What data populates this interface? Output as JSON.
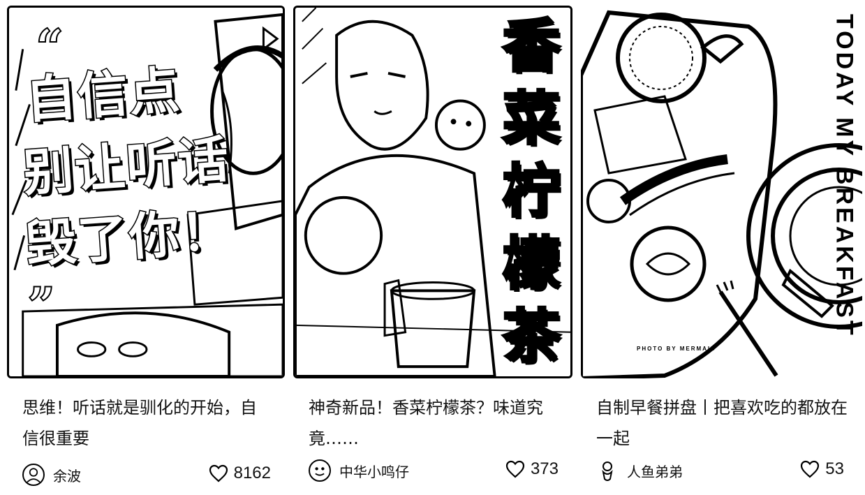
{
  "cards": [
    {
      "cover_lines": [
        "自信点",
        "别让听话",
        "毁了你！"
      ],
      "quote_open": "“",
      "quote_close": "”",
      "title": "思维！听话就是驯化的开始，自信很重要",
      "author": "余波",
      "likes": "8162"
    },
    {
      "cover_chars": [
        "香",
        "菜",
        "柠",
        "檬",
        "茶"
      ],
      "title": "神奇新品！香菜柠檬茶？味道究竟……",
      "author": "中华小鸣仔",
      "likes": "373"
    },
    {
      "cover_vertical": "TODAY MY BREAKFAST",
      "photo_credit": "PHOTO BY MERMAID",
      "title": "自制早餐拼盘丨把喜欢吃的都放在一起",
      "author": "人鱼弟弟",
      "likes": "53"
    }
  ],
  "icons": {
    "like": "heart-outline-icon",
    "play": "play-icon"
  },
  "colors": {
    "ink": "#000000",
    "paper": "#ffffff"
  }
}
